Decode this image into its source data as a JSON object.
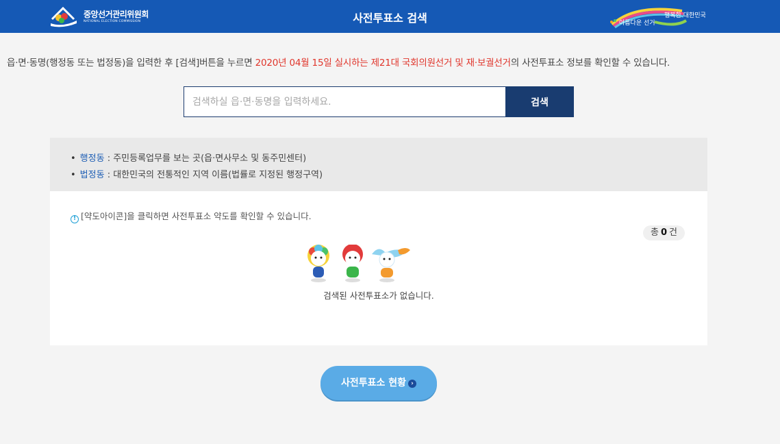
{
  "header": {
    "org_name_ko": "중앙선거관리위원회",
    "org_name_en": "NATIONAL ELECTION COMMISSION",
    "title": "사전투표소 검색",
    "slogan_left": "아름다운 선거",
    "slogan_right": "행복한 대한민국"
  },
  "intro": {
    "before": "읍·면·동명(행정동 또는 법정동)을 입력한 후 [검색]버튼을 누르면 ",
    "highlight": "2020년 04월 15일 실시하는 제21대 국회의원선거 및 재·보궐선거",
    "after": "의 사전투표소 정보를 확인할 수 있습니다."
  },
  "search": {
    "placeholder": "검색하실 읍·면·동명을 입력하세요.",
    "value": "",
    "button_label": "검색"
  },
  "info": {
    "items": [
      {
        "term": "행정동",
        "desc": " : 주민등록업무를 보는 곳(읍·면사무소 및 동주민센터)"
      },
      {
        "term": "법정동",
        "desc": " : 대한민국의 전통적인 지역 이름(법률로 지정된 행정구역)"
      }
    ]
  },
  "result": {
    "notice_icon": "!",
    "notice": "[약도아이콘]을 클릭하면 사전투표소 약도를 확인할 수 있습니다.",
    "count_prefix": "총",
    "count": "0",
    "count_suffix": "건",
    "empty_message": "검색된 사전투표소가 없습니다."
  },
  "footer": {
    "status_button_label": "사전투표소 현황",
    "status_button_icon": "chevron-right-icon"
  },
  "colors": {
    "header_bg": "#1559b5",
    "highlight": "#e0352b",
    "search_button": "#193c70",
    "status_button": "#5aabe6",
    "term": "#1f5fb5"
  }
}
